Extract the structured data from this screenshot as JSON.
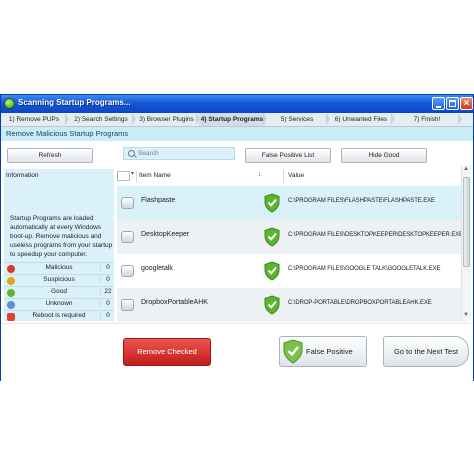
{
  "window": {
    "title": "Scanning Startup Programs..."
  },
  "steps": [
    "1) Remove PUPs",
    "2) Search Settings",
    "3) Browser Plugins",
    "4) Startup Programs",
    "5) Services",
    "6) Unwanted Files",
    "7) Finish!"
  ],
  "section": {
    "heading": "Remove Malicious Startup Programs"
  },
  "toolbar": {
    "refresh_label": "Refresh",
    "search_placeholder": "Search",
    "false_positive_list_label": "False Positive List",
    "hide_good_label": "Hide Good"
  },
  "info": {
    "title": "Information",
    "description": "Startup Programs are loaded automatically at every Windows boot-up. Remove malicious and useless programs from your startup to speedup your computer.",
    "statuses": [
      {
        "label": "Malicious",
        "count": "0",
        "icon": "malicious-icon",
        "color": "#d93a2b"
      },
      {
        "label": "Suspicious",
        "count": "0",
        "icon": "suspicious-icon",
        "color": "#e8a21c"
      },
      {
        "label": "Good",
        "count": "22",
        "icon": "good-icon",
        "color": "#5cb52f"
      },
      {
        "label": "Unknown",
        "count": "0",
        "icon": "unknown-icon",
        "color": "#5d8fd6"
      },
      {
        "label": "Reboot is required",
        "count": "0",
        "icon": "reboot-icon",
        "color": "#e0432d"
      }
    ]
  },
  "table": {
    "columns": {
      "name": "Item Name",
      "sort": "↓",
      "value": "Value"
    },
    "rows": [
      {
        "name": "Flashpaste",
        "value": "C:\\PROGRAM FILES\\FLASHPASTE\\FLASHPASTE.EXE",
        "status": "good"
      },
      {
        "name": "DesktopKeeper",
        "value": "C:\\PROGRAM FILES\\DESKTOPKEEPER\\DESKTOPKEEPER.EXE",
        "status": "good"
      },
      {
        "name": "googletalk",
        "value": "C:\\PROGRAM FILES\\GOOGLE TALK\\GOOGLETALK.EXE",
        "status": "good"
      },
      {
        "name": "DropboxPortableAHK",
        "value": "C:\\DROP-PORTABLE\\DROPBOXPORTABLEAHK.EXE",
        "status": "good"
      }
    ]
  },
  "actions": {
    "remove_checked": "Remove Checked",
    "false_positive": "False Positive",
    "next_test": "Go to the Next Test"
  },
  "colors": {
    "title_bar": "#1658d8",
    "selected_row": "#daf1fa",
    "alt_row": "#eef1f3",
    "remove_button": "#d92e2b",
    "shield_green": "#5cb52f"
  }
}
